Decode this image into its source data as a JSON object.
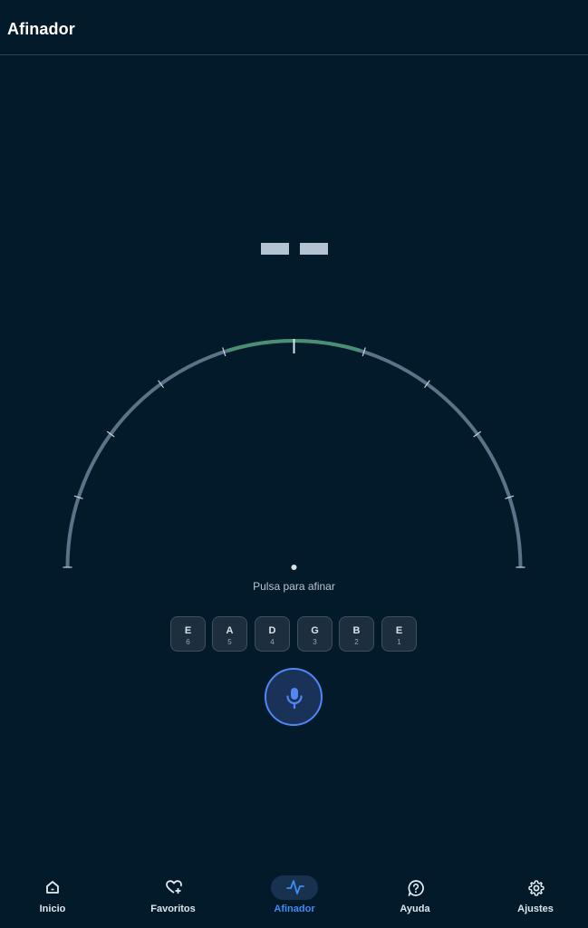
{
  "header": {
    "title": "Afinador"
  },
  "tuner": {
    "note_placeholder": "– –",
    "hint": "Pulsa para afinar",
    "colors": {
      "in_tune_arc": "#4a8f73",
      "gauge_arc": "#5b7389",
      "needle": "#d9e1e9"
    }
  },
  "strings": [
    {
      "note": "E",
      "number": "6"
    },
    {
      "note": "A",
      "number": "5"
    },
    {
      "note": "D",
      "number": "4"
    },
    {
      "note": "G",
      "number": "3"
    },
    {
      "note": "B",
      "number": "2"
    },
    {
      "note": "E",
      "number": "1"
    }
  ],
  "mic": {
    "icon": "microphone-icon",
    "accent": "#4f87f5"
  },
  "nav": [
    {
      "label": "Inicio",
      "icon": "home-icon"
    },
    {
      "label": "Favoritos",
      "icon": "heart-plus-icon"
    },
    {
      "label": "Afinador",
      "icon": "pulse-icon",
      "active": true
    },
    {
      "label": "Ayuda",
      "icon": "help-bubble-icon"
    },
    {
      "label": "Ajustes",
      "icon": "gear-icon"
    }
  ]
}
